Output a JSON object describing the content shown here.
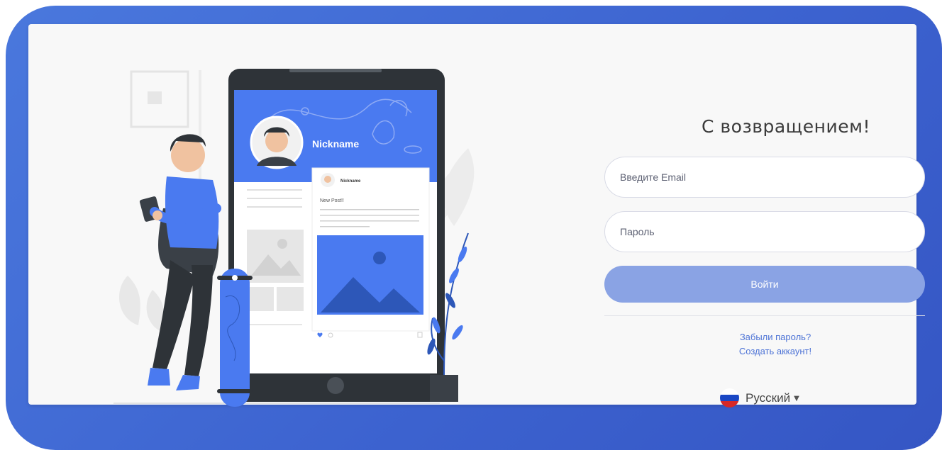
{
  "login": {
    "title": "С возвращением!",
    "email_placeholder": "Введите Email",
    "password_placeholder": "Пароль",
    "submit_label": "Войти",
    "forgot_password": "Забыли пароль?",
    "create_account": "Создать аккаунт!",
    "language": {
      "label": "Русский",
      "flag_icon": "russia-flag-icon",
      "flag_colors": [
        "#ffffff",
        "#1a47c4",
        "#d62828"
      ]
    }
  },
  "illustration": {
    "profile_name": "Nickname",
    "post_author": "Nickname",
    "post_text": "New Post!!"
  },
  "colors": {
    "backdrop": "#3c62cf",
    "accent": "#4a7af0",
    "button": "#8aa3e4",
    "link": "#4d73d6"
  }
}
